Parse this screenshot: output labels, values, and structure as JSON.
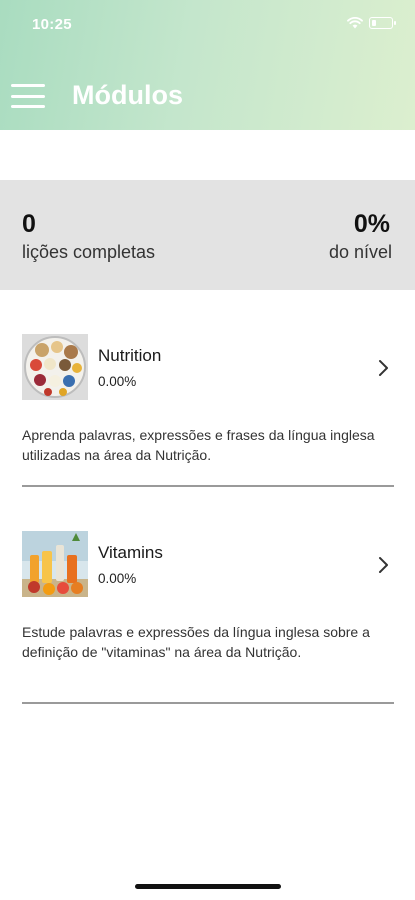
{
  "status_bar": {
    "time": "10:25"
  },
  "header": {
    "title": "Módulos"
  },
  "stats": {
    "lessons_completed_value": "0",
    "lessons_completed_label": "lições completas",
    "level_value": "0%",
    "level_label": "do nível"
  },
  "modules": [
    {
      "name": "Nutrition",
      "progress": "0.00%",
      "description": "Aprenda palavras, expressões e frases da língua inglesa utilizadas na área da Nutrição."
    },
    {
      "name": "Vitamins",
      "progress": "0.00%",
      "description": "Estude palavras e expressões da língua inglesa sobre a definição de \"vitaminas\" na área da Nutrição."
    }
  ],
  "colors": {
    "header_gradient_start": "#a9dcc0",
    "header_gradient_end": "#dcefcf",
    "stats_background": "#e3e3e3",
    "divider": "#9a9a9a"
  },
  "icons": [
    "menu-icon",
    "wifi-icon",
    "battery-icon",
    "chevron-right-icon"
  ]
}
